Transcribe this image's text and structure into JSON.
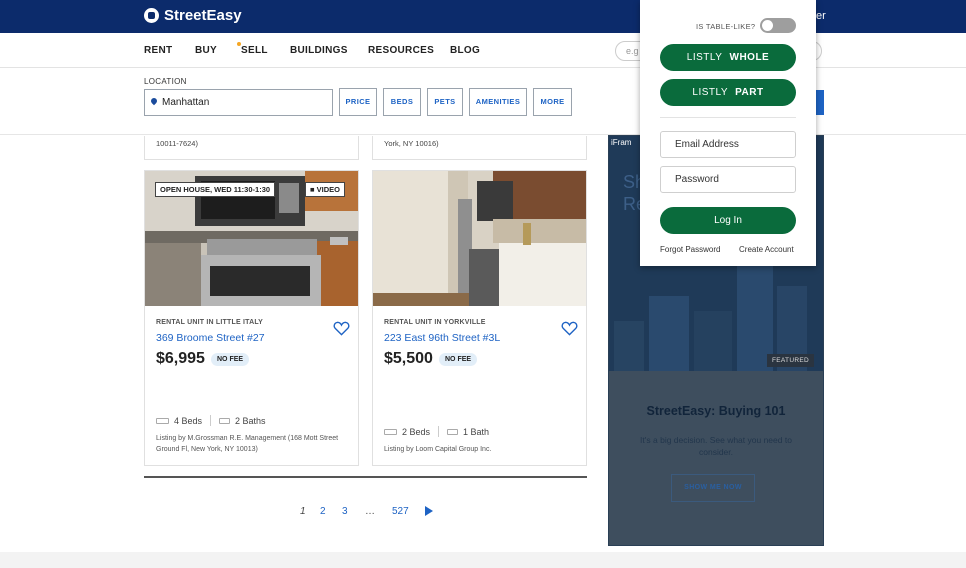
{
  "brand": {
    "name": "StreetEasy"
  },
  "topbar": {
    "right_text": "er"
  },
  "nav": {
    "items": [
      "RENT",
      "BUY",
      "SELL",
      "BUILDINGS",
      "RESOURCES",
      "BLOG"
    ],
    "search_placeholder": "e.g"
  },
  "filters": {
    "location_label": "LOCATION",
    "location_value": "Manhattan",
    "buttons": [
      "PRICE",
      "BEDS",
      "PETS",
      "AMENITIES",
      "MORE"
    ]
  },
  "prev_cards": [
    "10011-7624)",
    "York, NY 10016)"
  ],
  "listings": [
    {
      "badges": [
        "OPEN HOUSE, WED 11:30-1:30",
        "VIDEO"
      ],
      "type": "RENTAL UNIT IN LITTLE ITALY",
      "address": "369 Broome Street #27",
      "price": "$6,995",
      "fee": "NO FEE",
      "beds": "4 Beds",
      "baths": "2 Baths",
      "listing_by": "Listing by M.Grossman R.E. Management (168 Mott Street Ground Fl, New York, NY 10013)"
    },
    {
      "badges": [],
      "type": "RENTAL UNIT IN YORKVILLE",
      "address": "223 East 96th Street #3L",
      "price": "$5,500",
      "fee": "NO FEE",
      "beds": "2 Beds",
      "baths": "1 Bath",
      "listing_by": "Listing by Loom Capital Group Inc."
    }
  ],
  "pagination": {
    "pages": [
      "1",
      "2",
      "3",
      "…",
      "527"
    ],
    "current": "1"
  },
  "ad": {
    "frame_label": "iFram",
    "partial_text": [
      "Sh",
      "Re"
    ],
    "featured": "FEATURED",
    "title": "StreetEasy: Buying 101",
    "subtitle": "It's a big decision. See what you need to consider.",
    "button": "SHOW ME NOW"
  },
  "listly_panel": {
    "table_like_label": "IS TABLE-LIKE?",
    "whole_button": {
      "prefix": "LISTLY",
      "strong": "WHOLE"
    },
    "part_button": {
      "prefix": "LISTLY",
      "strong": "PART"
    },
    "email_placeholder": "Email Address",
    "password_placeholder": "Password",
    "login_button": "Log In",
    "forgot_password": "Forgot Password",
    "create_account": "Create Account"
  },
  "colors": {
    "navy": "#0c2b6b",
    "link_blue": "#1e63c4",
    "listly_green": "#0a6b3c"
  }
}
